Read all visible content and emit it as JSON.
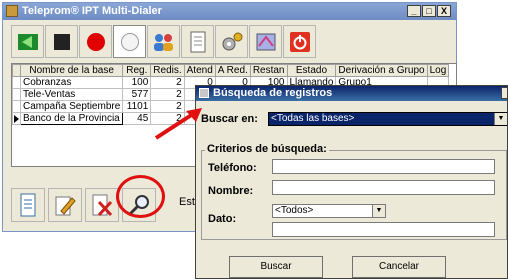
{
  "window": {
    "title": "Teleprom® IPT Multi-Dialer",
    "controls": [
      "_",
      "□",
      "X"
    ]
  },
  "toolbar": {
    "buttons": [
      {
        "icon": "green-export-icon"
      },
      {
        "icon": "stop-square-icon"
      },
      {
        "icon": "record-red-circle-icon"
      },
      {
        "icon": "white-circle-icon",
        "pressed": true
      },
      {
        "icon": "users-group-icon"
      },
      {
        "icon": "document-list-icon"
      },
      {
        "icon": "gear-settings-icon"
      },
      {
        "icon": "network-icon"
      },
      {
        "icon": "power-icon"
      }
    ]
  },
  "grid": {
    "columns": [
      "Nombre de la base",
      "Reg.",
      "Redis.",
      "Atend",
      "A Red.",
      "Restan",
      "Estado",
      "Derivación a Grupo",
      "Log"
    ],
    "rows": [
      [
        "Cobranzas",
        "100",
        "2",
        "0",
        "0",
        "100",
        "Llamando",
        "Grupo1",
        ""
      ],
      [
        "Tele-Ventas",
        "577",
        "2",
        "",
        "",
        "",
        "",
        "",
        ""
      ],
      [
        "Campaña Septiembre",
        "1101",
        "2",
        "",
        "",
        "",
        "",
        "",
        ""
      ],
      [
        "Banco de la Provincia",
        "45",
        "2",
        "",
        "",
        "",
        "",
        "",
        ""
      ]
    ]
  },
  "bottom_toolbar": {
    "buttons": [
      "new-document-icon",
      "edit-pencil-icon",
      "delete-document-icon",
      "search-magnifier-icon"
    ],
    "status_text": "Esta"
  },
  "dialog": {
    "title": "Búsqueda de registros",
    "buscar_en_label": "Buscar en:",
    "buscar_en_value": "<Todas las bases>",
    "group_label": "Criterios de búsqueda:",
    "telefono_label": "Teléfono:",
    "nombre_label": "Nombre:",
    "dato_label": "Dato:",
    "dato_value": "<Todos>",
    "buscar_button": "Buscar",
    "cancelar_button": "Cancelar"
  },
  "colors": {
    "selection": "#0a246a",
    "annotation": "#e01010",
    "window_bg": "#ece9d8"
  }
}
